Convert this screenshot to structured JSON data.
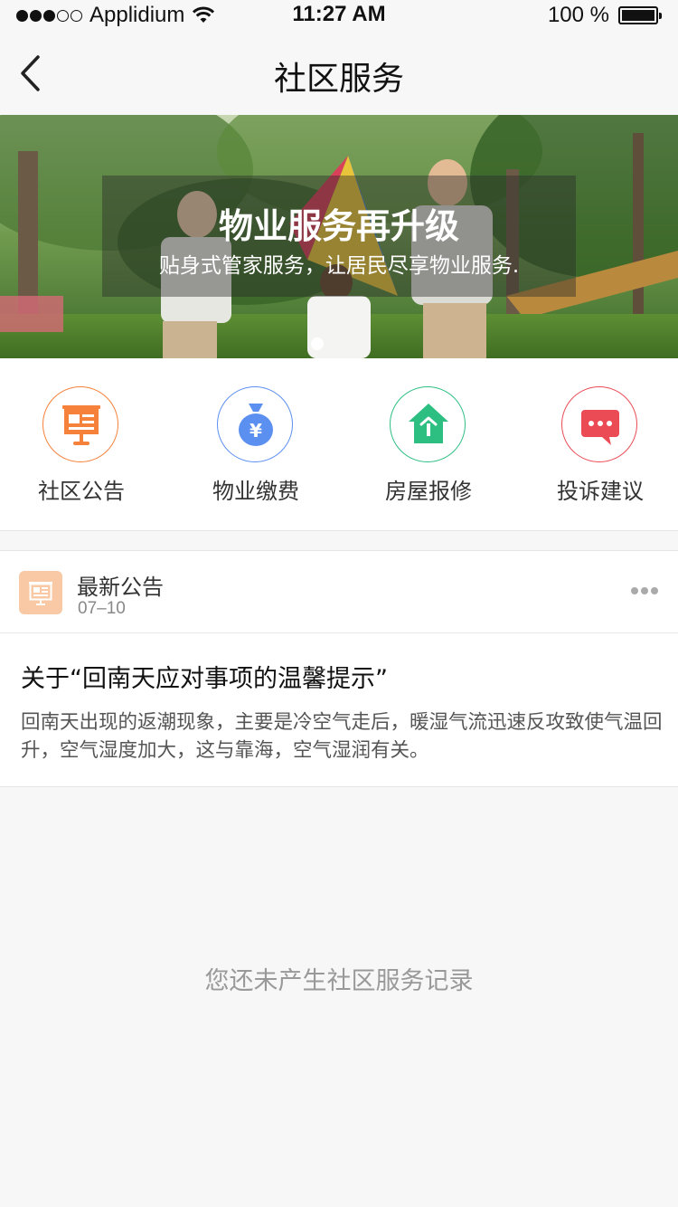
{
  "status_bar": {
    "carrier": "Applidium",
    "time": "11:27 AM",
    "battery": "100 %",
    "signal_dots_filled": 3,
    "signal_dots_total": 5
  },
  "nav": {
    "title": "社区服务",
    "back_icon": "chevron-left-icon"
  },
  "banner": {
    "title": "物业服务再升级",
    "subtitle": "贴身式管家服务，让居民尽享物业服务."
  },
  "services": [
    {
      "label": "社区公告",
      "icon": "announcement-board-icon",
      "color": "#f5813b"
    },
    {
      "label": "物业缴费",
      "icon": "money-bag-icon",
      "color": "#5b8ff0"
    },
    {
      "label": "房屋报修",
      "icon": "house-repair-icon",
      "color": "#2dbf82"
    },
    {
      "label": "投诉建议",
      "icon": "chat-bubble-icon",
      "color": "#ea4b55"
    }
  ],
  "notice": {
    "header_title": "最新公告",
    "date": "07–10",
    "title": "关于“回南天应对事项的温馨提示”",
    "body": "回南天出现的返潮现象，主要是冷空气走后，暖湿气流迅速反攻致使气温回升，空气湿度加大，这与靠海，空气湿润有关。"
  },
  "empty_state": "您还未产生社区服务记录"
}
